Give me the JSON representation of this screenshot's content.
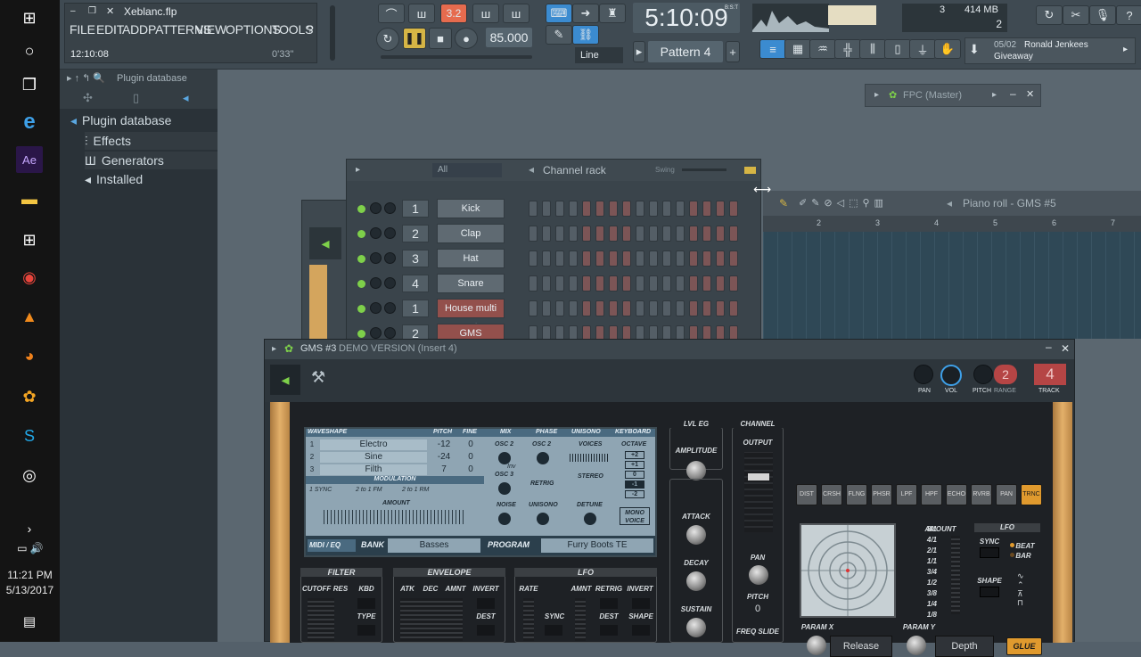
{
  "taskbar": {
    "time": "11:21 PM",
    "date": "5/13/2017"
  },
  "title_bar": {
    "filename": "Xeblanc.flp",
    "time_display": "12:10:08",
    "duration": "0'33\""
  },
  "menu": [
    "FILE",
    "EDIT",
    "ADD",
    "PATTERNS",
    "VIEW",
    "OPTIONS",
    "TOOLS",
    "?"
  ],
  "transport": {
    "tempo": "85.000",
    "song_time": "5:10:09",
    "time_suffix": "B:S:T",
    "snap": "Line",
    "pattern": "Pattern 4",
    "counter": "3.2"
  },
  "status": {
    "cpu_voices": "3",
    "memory": "414 MB",
    "mem_sub": "2"
  },
  "news": {
    "date": "05/02",
    "author": "Ronald Jenkees",
    "text": "Giveaway"
  },
  "browser": {
    "header": "Plugin database",
    "items": [
      "Plugin database",
      "Effects",
      "Generators",
      "Installed"
    ]
  },
  "fpc_window": {
    "title": "FPC (Master)"
  },
  "channel_rack": {
    "filter": "All",
    "title": "Channel rack",
    "swing_label": "Swing",
    "channels": [
      {
        "num": "1",
        "name": "Kick"
      },
      {
        "num": "2",
        "name": "Clap"
      },
      {
        "num": "3",
        "name": "Hat"
      },
      {
        "num": "4",
        "name": "Snare"
      },
      {
        "num": "1",
        "name": "House multi out"
      },
      {
        "num": "2",
        "name": "GMS"
      }
    ]
  },
  "piano_roll": {
    "title": "Piano roll - GMS #5",
    "bars": [
      "2",
      "3",
      "4",
      "5",
      "6",
      "7"
    ]
  },
  "gms": {
    "title": "GMS #3",
    "title_suffix": "DEMO VERSION (Insert 4)",
    "pan_label": "PAN",
    "vol_label": "VOL",
    "pitch_label": "PITCH",
    "range_label": "RANGE",
    "range_value": "2",
    "track_label": "TRACK",
    "track_value": "4",
    "headers": [
      "WAVESHAPE",
      "PITCH",
      "FINE",
      "MIX",
      "PHASE",
      "UNISONO",
      "KEYBOARD"
    ],
    "osc": [
      {
        "n": "1",
        "wave": "Electro",
        "pitch": "-12",
        "fine": "0"
      },
      {
        "n": "2",
        "wave": "Sine",
        "pitch": "-24",
        "fine": "0"
      },
      {
        "n": "3",
        "wave": "Filth",
        "pitch": "7",
        "fine": "0"
      }
    ],
    "modulation_label": "MODULATION",
    "mod_options": [
      "1 SYNC",
      "2 to 1 FM",
      "2 to 1 RM"
    ],
    "amount_label": "AMOUNT",
    "mix_labels": [
      "OSC 2",
      "OSC 3",
      "NOISE",
      "Inv"
    ],
    "phase_labels": [
      "OSC 2",
      "RETRIG",
      "UNISONO"
    ],
    "unisono_labels": [
      "VOICES",
      "STEREO",
      "DETUNE"
    ],
    "keyboard_labels": [
      "OCTAVE",
      "+2",
      "+1",
      "0",
      "-1",
      "-2",
      "MONO VOICE"
    ],
    "midi_eq": "MIDI / EQ",
    "bank_label": "BANK",
    "bank_value": "Basses",
    "program_label": "PROGRAM",
    "program_value": "Furry Boots TE",
    "lvl_eg": "LVL EG",
    "amplitude": "AMPLITUDE",
    "attack": "ATTACK",
    "decay": "DECAY",
    "sustain": "SUSTAIN",
    "channel": "CHANNEL",
    "output": "OUTPUT",
    "pan": "PAN",
    "pitch": "PITCH",
    "pitch_value": "0",
    "freq_slide": "FREQ SLIDE",
    "fx_buttons": [
      "DIST",
      "CRSH",
      "FLNG",
      "PHSR",
      "LPF",
      "HPF",
      "ECHO",
      "RVRB",
      "PAN",
      "TRNC"
    ],
    "lfo_rates": [
      "8/1",
      "4/1",
      "2/1",
      "1/1",
      "3/4",
      "1/2",
      "3/8",
      "1/4",
      "1/8"
    ],
    "lfo_title": "LFO",
    "sync": "SYNC",
    "beat": "BEAT",
    "bar": "BAR",
    "shape": "SHAPE",
    "param_x": "PARAM X",
    "param_y": "PARAM Y",
    "param_x_value": "Release",
    "param_y_value": "Depth",
    "glue": "GLUE",
    "filter": "FILTER",
    "filter_labels": [
      "CUTOFF",
      "RES",
      "KBD",
      "TYPE"
    ],
    "envelope": "ENVELOPE",
    "env_labels": [
      "ATK",
      "DEC",
      "AMNT",
      "INVERT",
      "DEST"
    ],
    "lfo2": "LFO",
    "lfo2_labels": [
      "RATE",
      "AMNT",
      "RETRIG",
      "INVERT",
      "SYNC",
      "DEST",
      "SHAPE"
    ]
  }
}
